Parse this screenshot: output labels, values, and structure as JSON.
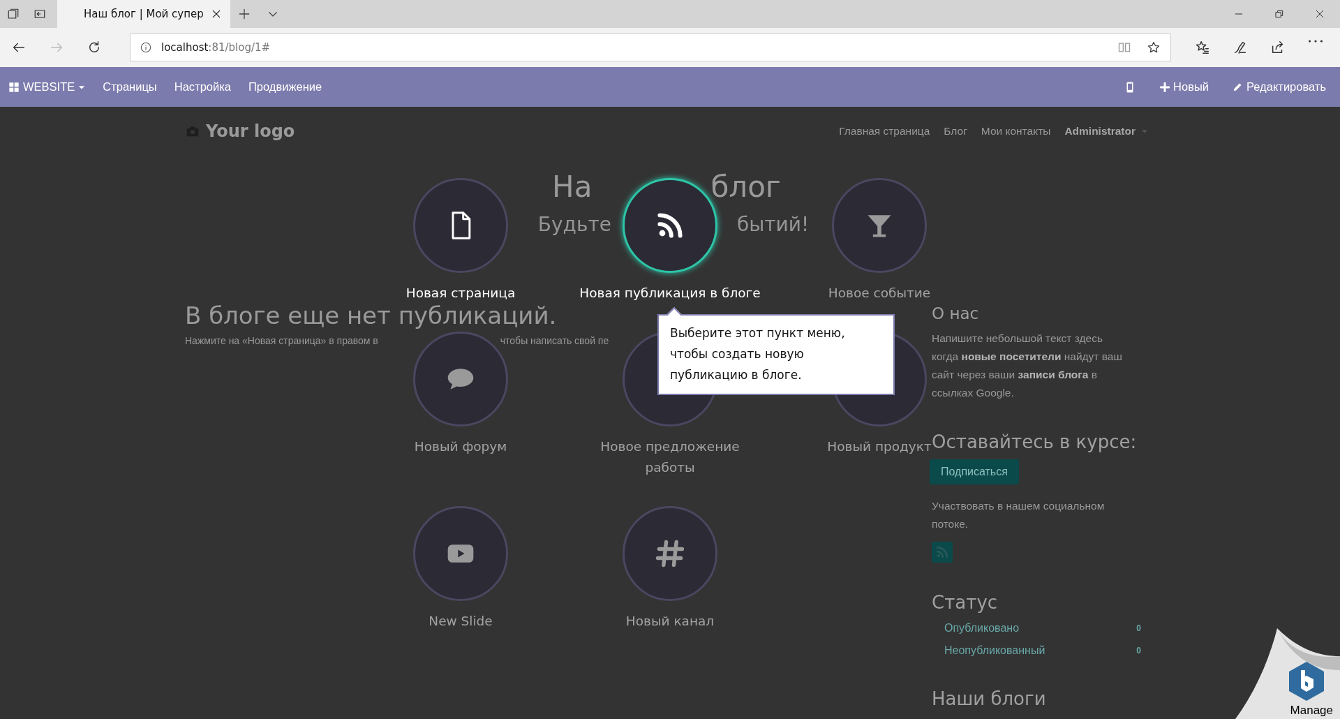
{
  "browser": {
    "tab": {
      "title": "Наш блог | Мой супер"
    },
    "nav_buttons": [
      {
        "kind": "back",
        "enabled": true
      },
      {
        "kind": "forward",
        "enabled": false
      },
      {
        "kind": "refresh",
        "enabled": true
      }
    ],
    "address": {
      "host": "localhost",
      "path": ":81/blog/1#"
    }
  },
  "admin_bar": {
    "brand": "WEBSITE",
    "menu": [
      "Страницы",
      "Настройка",
      "Продвижение"
    ],
    "actions": [
      {
        "kind": "new",
        "label": "Новый"
      },
      {
        "kind": "edit",
        "label": "Редактировать"
      }
    ]
  },
  "site": {
    "logo": "Your logo",
    "nav": [
      "Главная страница",
      "Блог",
      "Мои контакты"
    ],
    "user": "Administrator"
  },
  "blog": {
    "title_parts": [
      "На",
      "блог"
    ],
    "subtitle_parts": [
      "Будьте",
      "бытий!"
    ],
    "empty_heading": "В блоге еще нет публикаций.",
    "hint_parts": [
      "Нажмите на «Новая страница» в правом в",
      "чтобы написать свой пе"
    ]
  },
  "sidebar": {
    "about_title": "О нас",
    "about_text": "Напишите небольшой текст здесь когда **новые посетители** найдут ваш сайт через ваши **записи блога** в ссылках Google.",
    "follow_title": "Оставайтесь в курсе:",
    "subscribe": "Подписаться",
    "social_text": "Участвовать в нашем социальном потоке.",
    "status_title": "Статус",
    "status": [
      {
        "label": "Опубликовано",
        "count": "0"
      },
      {
        "label": "Неопубликованный",
        "count": "0"
      }
    ],
    "blogs_title": "Наши блоги"
  },
  "new_content_menu": {
    "items": [
      {
        "label": "Новая страница",
        "kind": "page",
        "enabled": true,
        "selected": false
      },
      {
        "label": "Новая публикация в блоге",
        "kind": "rss",
        "enabled": true,
        "selected": true
      },
      {
        "label": "Новое событие",
        "kind": "event",
        "enabled": false,
        "selected": false
      },
      {
        "label": "Новый форум",
        "kind": "forum",
        "enabled": false,
        "selected": false
      },
      {
        "label": "Новое предложение работы",
        "kind": "job",
        "enabled": false,
        "selected": false
      },
      {
        "label": "Новый продукт",
        "kind": "product",
        "enabled": false,
        "selected": false
      },
      {
        "label": "New Slide",
        "kind": "slide",
        "enabled": false,
        "selected": false
      },
      {
        "label": "Новый канал",
        "kind": "channel",
        "enabled": false,
        "selected": false
      }
    ],
    "tooltip": "Выберите этот пункт меню, чтобы создать новую публикацию в блоге."
  },
  "manage_badge": {
    "label": "Manage"
  }
}
